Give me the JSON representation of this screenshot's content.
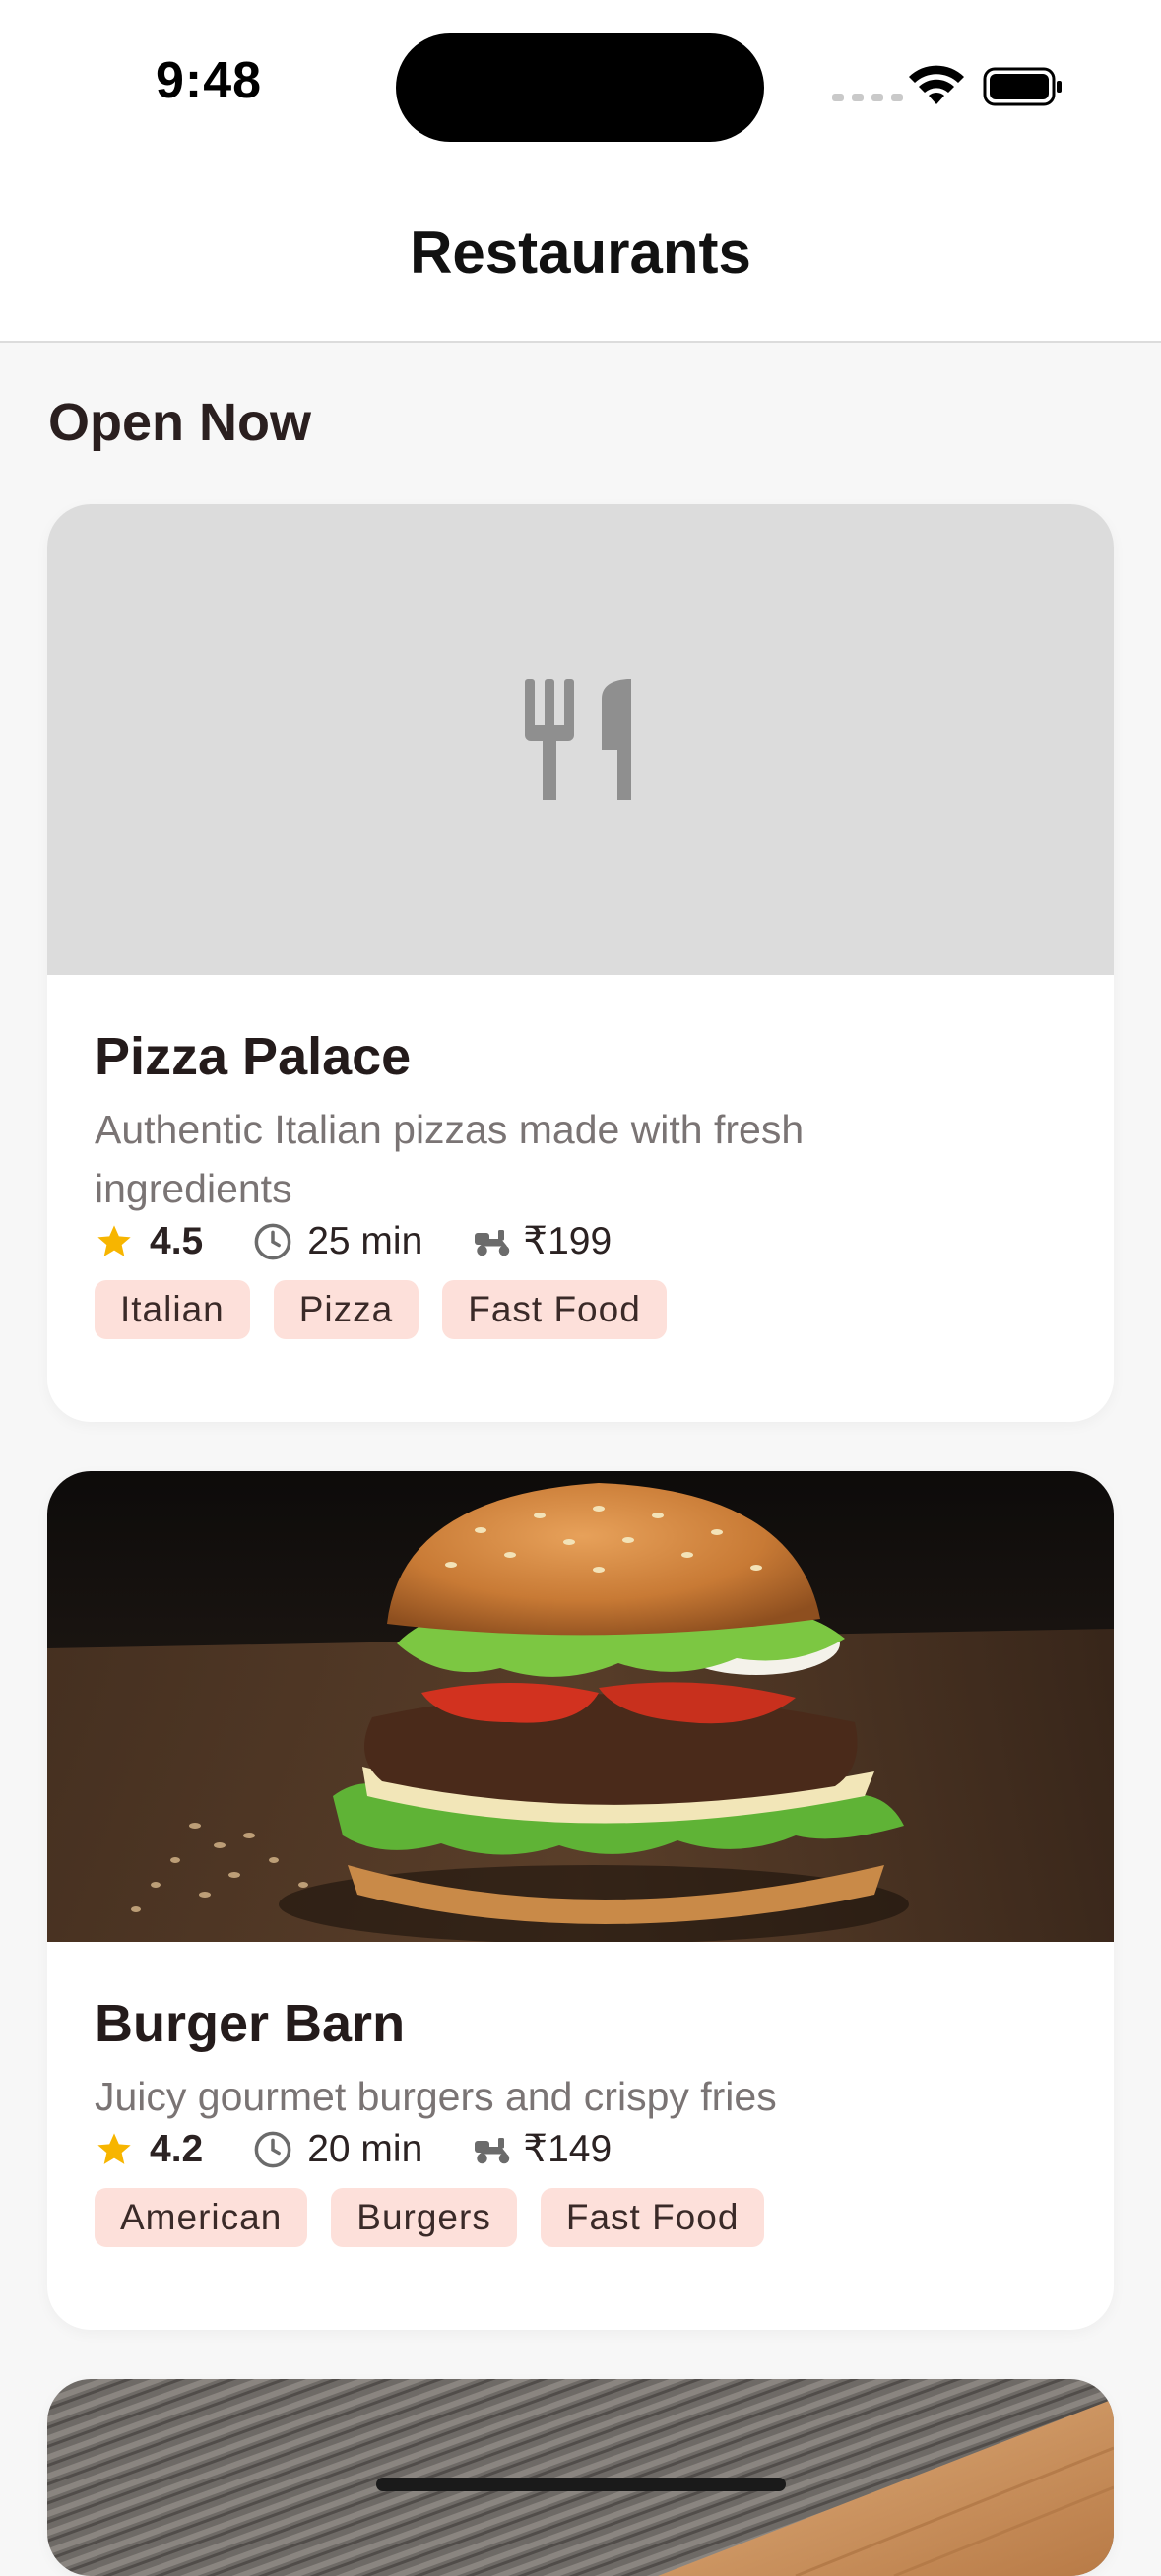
{
  "status_bar": {
    "time": "9:48"
  },
  "header": {
    "title": "Restaurants"
  },
  "section": {
    "title": "Open Now"
  },
  "restaurants": [
    {
      "name": "Pizza Palace",
      "description": "Authentic Italian pizzas made with fresh ingredients",
      "rating": "4.5",
      "eta": "25 min",
      "fee": "₹199",
      "tags": [
        "Italian",
        "Pizza",
        "Fast Food"
      ],
      "image": "placeholder-utensils-icon"
    },
    {
      "name": "Burger Barn",
      "description": "Juicy gourmet burgers and crispy fries",
      "rating": "4.2",
      "eta": "20 min",
      "fee": "₹149",
      "tags": [
        "American",
        "Burgers",
        "Fast Food"
      ],
      "image": "burger-photo"
    }
  ],
  "colors": {
    "accent_tag_bg": "#fde0da",
    "star": "#f7b500",
    "placeholder_bg": "#dcdcdc"
  }
}
